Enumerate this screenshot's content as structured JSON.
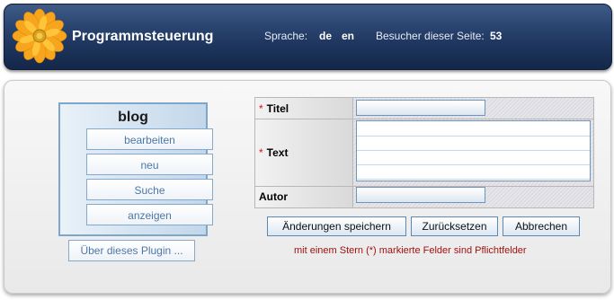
{
  "header": {
    "title": "Programmsteuerung",
    "language_label": "Sprache:",
    "languages": [
      "de",
      "en"
    ],
    "visitor_label": "Besucher dieser Seite:",
    "visitor_count": "53",
    "logo_icon": "orange-flower-icon",
    "colors": {
      "header_bg": "#1f3760",
      "header_text": "#ffffff"
    }
  },
  "sidebar": {
    "title": "blog",
    "items": [
      "bearbeiten",
      "neu",
      "Suche",
      "anzeigen"
    ],
    "about_label": "Über dieses Plugin ..."
  },
  "form": {
    "fields": [
      {
        "label": "Titel",
        "required": true,
        "value": ""
      },
      {
        "label": "Text",
        "required": true,
        "value": ""
      },
      {
        "label": "Autor",
        "required": false,
        "value": ""
      }
    ],
    "required_marker": "*",
    "buttons": {
      "save": "Änderungen speichern",
      "reset": "Zurücksetzen",
      "cancel": "Abbrechen"
    },
    "hint": "mit einem Stern (*) markierte Felder sind Pflichtfelder",
    "colors": {
      "required_star": "#dd1111",
      "hint_text": "#a11212"
    }
  }
}
